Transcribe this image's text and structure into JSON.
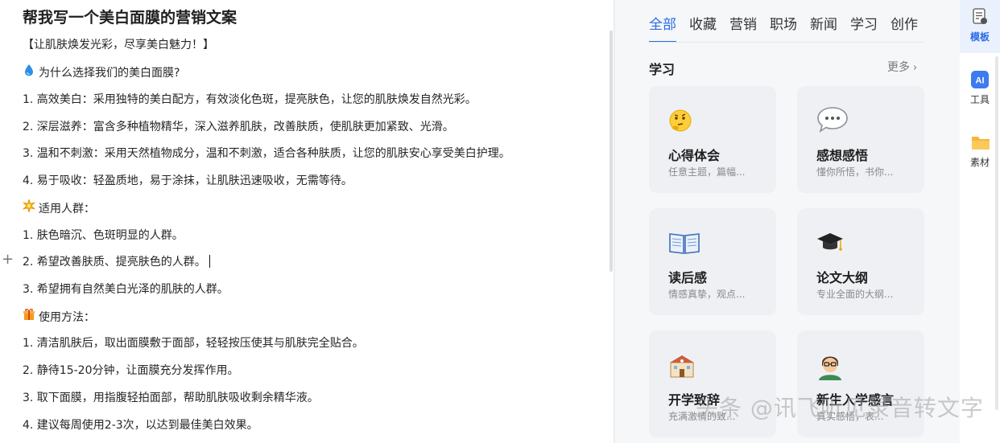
{
  "document": {
    "title": "帮我写一个美白面膜的营销文案",
    "lines": [
      "【让肌肤焕发光彩，尽享美白魅力！】",
      "为什么选择我们的美白面膜?",
      "1. 高效美白：采用独特的美白配方，有效淡化色斑，提亮肤色，让您的肌肤焕发自然光彩。",
      "2. 深层滋养：富含多种植物精华，深入滋养肌肤，改善肤质，使肌肤更加紧致、光滑。",
      "3. 温和不刺激：采用天然植物成分，温和不刺激，适合各种肤质，让您的肌肤安心享受美白护理。",
      "4. 易于吸收：轻盈质地，易于涂抹，让肌肤迅速吸收，无需等待。",
      "适用人群：",
      "1. 肤色暗沉、色斑明显的人群。",
      "2. 希望改善肤质、提亮肤色的人群。",
      "3. 希望拥有自然美白光泽的肌肤的人群。",
      "使用方法：",
      "1. 清洁肌肤后，取出面膜敷于面部，轻轻按压使其与肌肤完全贴合。",
      "2. 静待15-20分钟，让面膜充分发挥作用。",
      "3. 取下面膜，用指腹轻拍面部，帮助肌肤吸收剩余精华液。",
      "4. 建议每周使用2-3次，以达到最佳美白效果。"
    ],
    "plus_symbol": "+"
  },
  "panel": {
    "tabs": [
      "全部",
      "收藏",
      "营销",
      "职场",
      "新闻",
      "学习",
      "创作"
    ],
    "active_tab": "全部",
    "section_title": "学习",
    "more_label": "更多",
    "cards": [
      {
        "name": "心得体会",
        "desc": "任意主题，篇幅...",
        "icon": "thinking-face-icon"
      },
      {
        "name": "感想感悟",
        "desc": "懂你所悟，书你...",
        "icon": "speech-bubble-icon"
      },
      {
        "name": "读后感",
        "desc": "情感真挚，观点...",
        "icon": "open-book-icon"
      },
      {
        "name": "论文大纲",
        "desc": "专业全面的大纲...",
        "icon": "graduation-cap-icon"
      },
      {
        "name": "开学致辞",
        "desc": "充满激情的致...",
        "icon": "school-building-icon"
      },
      {
        "name": "新生入学感言",
        "desc": "真实感悟，表...",
        "icon": "teacher-icon"
      }
    ]
  },
  "sidebar": {
    "items": [
      {
        "label": "模板",
        "icon": "template-doc-icon",
        "active": true
      },
      {
        "label": "工具",
        "icon": "ai-badge-icon",
        "ai_text": "AI",
        "active": false
      },
      {
        "label": "素材",
        "icon": "folder-icon",
        "active": false
      }
    ]
  },
  "watermark": "头条 @讯飞听见录音转文字",
  "colors": {
    "accent": "#2b6be6",
    "card_bg": "#eef0f4",
    "panel_bg": "#f6f7f9"
  }
}
